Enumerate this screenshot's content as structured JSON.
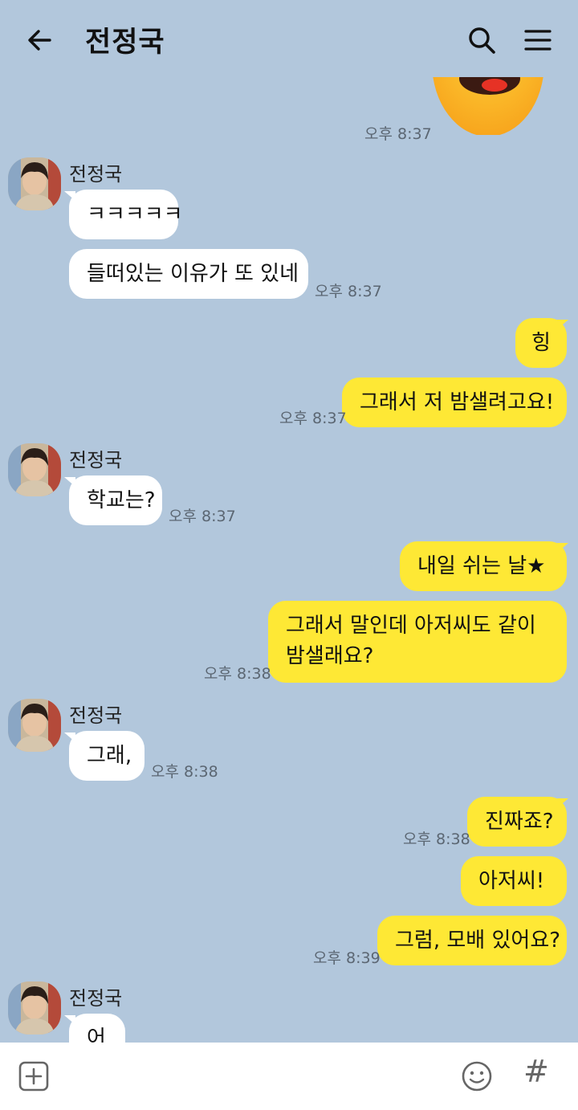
{
  "header": {
    "title": "전정국",
    "back_icon": "arrow-left-icon",
    "search_icon": "search-icon",
    "menu_icon": "hamburger-menu-icon"
  },
  "messages": {
    "sticker": {
      "time": "오후 8:37",
      "icon": "crying-emoji-sticker"
    },
    "g1": {
      "sender": "전정국",
      "m1": "ㅋㅋㅋㅋㅋ",
      "m2": "들떠있는 이유가 또 있네",
      "time": "오후 8:37"
    },
    "o1": {
      "m1": "힝",
      "m2": "그래서 저 밤샐려고요!",
      "time": "오후 8:37"
    },
    "g2": {
      "sender": "전정국",
      "m1": "학교는?",
      "time": "오후 8:37"
    },
    "o2": {
      "m1": "내일 쉬는 날★",
      "m2_line1": "그래서 말인데 아저씨도 같이",
      "m2_line2": "밤샐래요?",
      "time": "오후 8:38"
    },
    "g3": {
      "sender": "전정국",
      "m1": "그래,",
      "time": "오후 8:38"
    },
    "o3": {
      "m1": "진짜죠?",
      "m1_time": "오후 8:38",
      "m2": "아저씨!",
      "m3": "그럼, 모배 있어요?",
      "time": "오후 8:39"
    },
    "g4": {
      "sender": "전정국",
      "m1": "어"
    }
  },
  "composer": {
    "plus_icon": "plus-square-icon",
    "emoji_icon": "smiley-icon",
    "hashtag": "#"
  },
  "colors": {
    "background": "#b2c7dc",
    "outgoing_bubble": "#fee835",
    "incoming_bubble": "#ffffff"
  }
}
